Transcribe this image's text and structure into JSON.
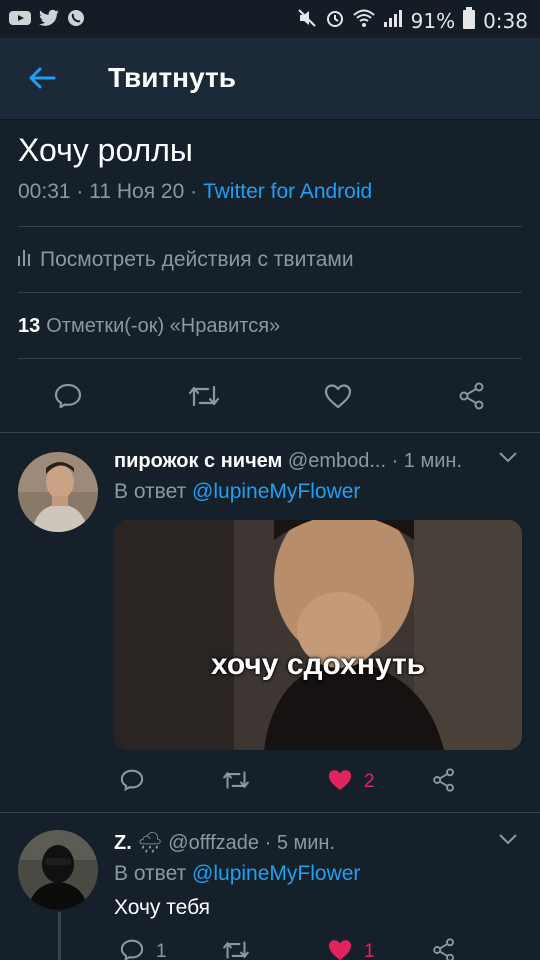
{
  "status_bar": {
    "battery": "91%",
    "time": "0:38",
    "icons": [
      "youtube-icon",
      "twitter-icon",
      "viber-icon",
      "mute-icon",
      "alarm-icon",
      "wifi-icon",
      "signal-icon",
      "battery-icon"
    ]
  },
  "header": {
    "title": "Твитнуть"
  },
  "tweet": {
    "text": "Хочу роллы",
    "time": "00:31",
    "date": "11 Ноя 20",
    "source": "Twitter for Android",
    "activity_label": "Посмотреть действия с твитами",
    "likes_count": "13",
    "likes_label": "Отметки(-ок) «Нравится»"
  },
  "replies": [
    {
      "name": "пирожок с ничем",
      "handle": "@embod...",
      "time": "· 1 мин.",
      "reply_prefix": "В ответ",
      "reply_to": "@lupineMyFlower",
      "media_caption": "хочу сдохнуть",
      "likes": "2",
      "liked": true
    },
    {
      "name": "Z.",
      "emoji": "🌧",
      "handle": "@offfzade",
      "time": "· 5 мин.",
      "reply_prefix": "В ответ",
      "reply_to": "@lupineMyFlower",
      "text": "Хочу тебя",
      "replies_count": "1",
      "likes": "1",
      "liked": true
    }
  ],
  "colors": {
    "background": "#15202b",
    "header": "#1c2938",
    "accent": "#1da1f2",
    "muted": "#8899a6",
    "like": "#e0245e"
  }
}
